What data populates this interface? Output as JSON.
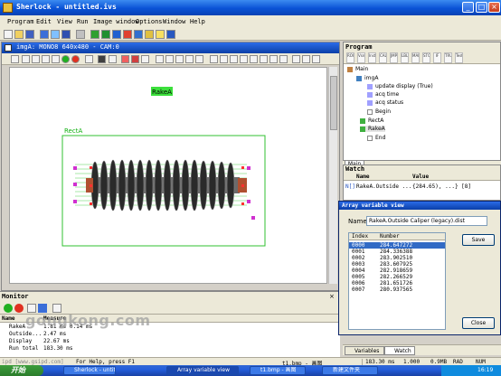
{
  "window": {
    "title": "Sherlock - untitled.ivs"
  },
  "menu": [
    "Program",
    "Edit",
    "View",
    "Run",
    "Image window",
    "Options",
    "Window",
    "Help"
  ],
  "image_window": {
    "title": "imgA: MONO8 640x480 - CAM:0",
    "rake_label": "RakeA",
    "rect_label": "RectA"
  },
  "monitor": {
    "title": "Monitor",
    "columns": [
      "Name",
      "Measure"
    ],
    "rows": [
      {
        "name": "RakeA",
        "value": "1.81 ms  0.14 ms"
      },
      {
        "name": "Outside...",
        "value": "2.47 ms"
      },
      {
        "name": "Display",
        "value": "22.67 ms"
      },
      {
        "name": "Run total",
        "value": "183.30 ms"
      }
    ]
  },
  "status": {
    "help": "For Help, press F1",
    "file": "t1.bmp - 画图",
    "timing": "183.30 ms",
    "scale": "1.000",
    "mem": "0.9MB",
    "mode": "RAD",
    "num": "NUM"
  },
  "watermark": {
    "main": "gongkong.com",
    "sub": "ipd [www.gsipd.com]"
  },
  "program": {
    "title": "Program",
    "toolbar": [
      "ROI",
      "Vsns",
      "Inst",
      "CALL",
      "JMP",
      "LBL",
      "MARK",
      "STOP",
      "IF",
      "TRUE",
      "Test"
    ],
    "tree": [
      {
        "label": "Main",
        "depth": 0
      },
      {
        "label": "imgA",
        "depth": 1
      },
      {
        "label": "update display (True)",
        "depth": 2
      },
      {
        "label": "acq time",
        "depth": 2
      },
      {
        "label": "acq status",
        "depth": 2
      },
      {
        "label": "Begin",
        "depth": 1
      },
      {
        "label": "RectA",
        "depth": 1
      },
      {
        "label": "RakeA",
        "depth": 1
      },
      {
        "label": "End",
        "depth": 1
      }
    ],
    "tab": "Main"
  },
  "watch": {
    "title": "Watch",
    "columns": [
      "Name",
      "Value"
    ],
    "row": {
      "name": "RakeA.Outside ...",
      "value": "{284.65), ...} [8]"
    }
  },
  "array_dialog": {
    "title": "Array variable view",
    "name_label": "Name",
    "name_value": "RakeA.Outside Caliper (legacy).dist",
    "columns": [
      "Index",
      "Number"
    ],
    "rows": [
      {
        "index": "0000",
        "number": "284.647272"
      },
      {
        "index": "0001",
        "number": "284.336388"
      },
      {
        "index": "0002",
        "number": "283.902510"
      },
      {
        "index": "0003",
        "number": "283.607925"
      },
      {
        "index": "0004",
        "number": "282.918659"
      },
      {
        "index": "0005",
        "number": "282.266529"
      },
      {
        "index": "0006",
        "number": "281.651726"
      },
      {
        "index": "0007",
        "number": "280.937565"
      }
    ],
    "save": "Save",
    "close": "Close"
  },
  "bottom_tabs": [
    "Variables",
    "Watch"
  ],
  "taskbar": {
    "start": "开始",
    "tasks": [
      "Sherlock - untit...",
      "Array variable view",
      "t1.bmp - 画图",
      "新建文件夹"
    ],
    "clock": "16:19"
  }
}
